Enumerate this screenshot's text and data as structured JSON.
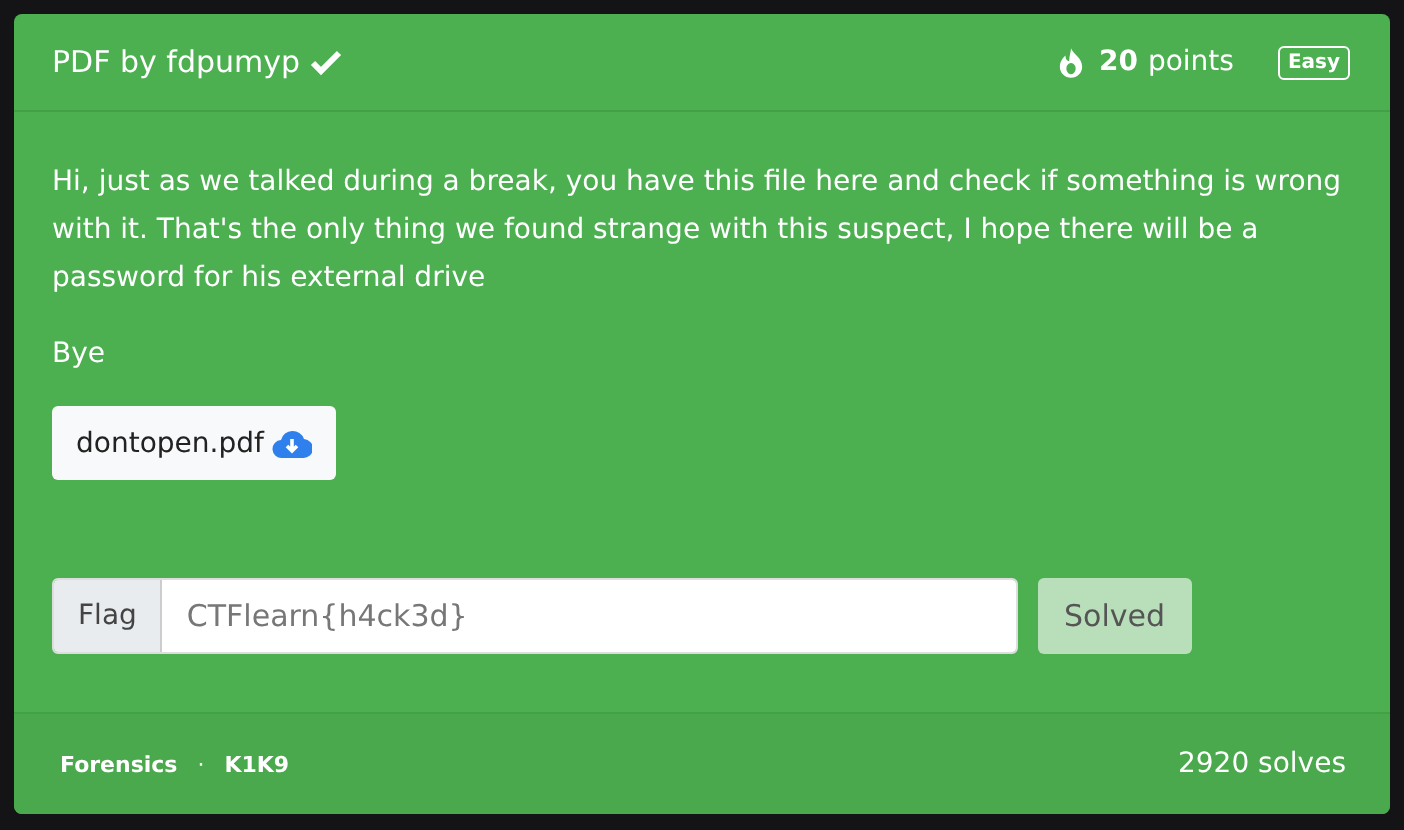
{
  "header": {
    "title": "PDF by fdpumyp",
    "solved": true,
    "points": "20",
    "points_label": "points",
    "difficulty": "Easy"
  },
  "body": {
    "paragraphs": [
      "Hi, just as we talked during a break, you have this file here and check if something is wrong with it. That's the only thing we found strange with this suspect, I hope there will be a password for his external drive",
      "Bye"
    ],
    "file": {
      "label": "dontopen.pdf"
    },
    "flag": {
      "label": "Flag",
      "value": "CTFlearn{h4ck3d}",
      "disabled": true
    },
    "submit": {
      "label": "Solved",
      "disabled": true
    }
  },
  "footer": {
    "category": "Forensics",
    "separator": "·",
    "author": "K1K9",
    "solves": "2920 solves"
  }
}
